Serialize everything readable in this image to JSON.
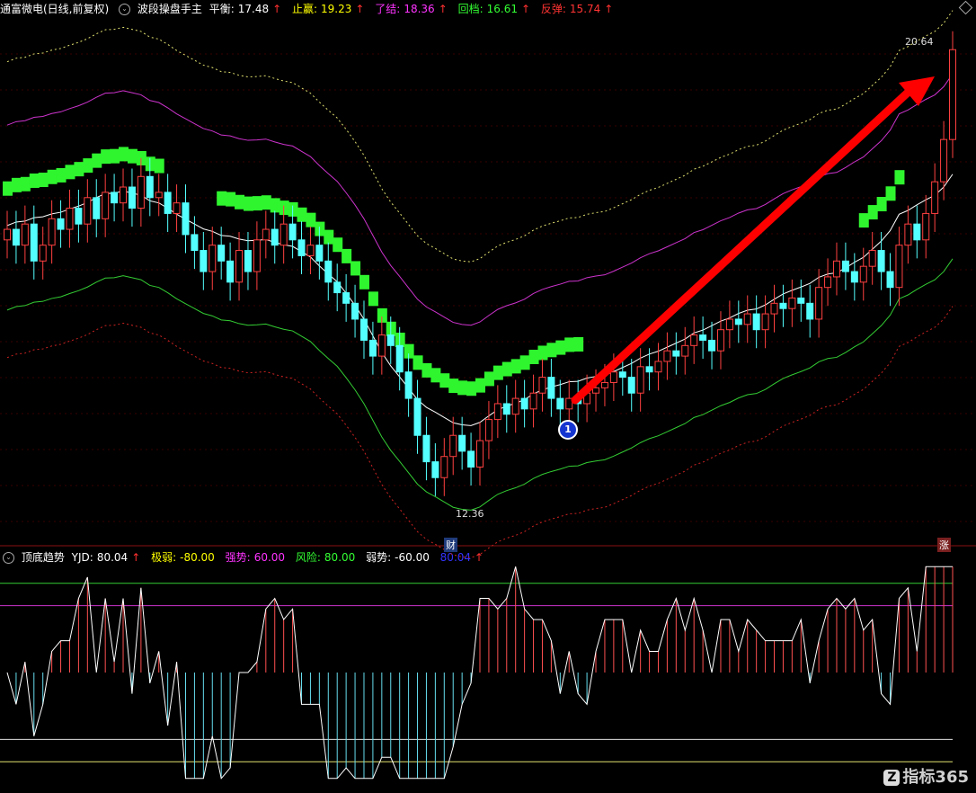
{
  "header": {
    "title": "通富微电(日线,前复权)",
    "indicator": "波段操盘手主",
    "items": [
      {
        "label": "平衡:",
        "value": "17.48",
        "color": "#ffffff"
      },
      {
        "label": "止赢:",
        "value": "19.23",
        "color": "#ffff00"
      },
      {
        "label": "了结:",
        "value": "18.36",
        "color": "#ff33ff"
      },
      {
        "label": "回档:",
        "value": "16.61",
        "color": "#33ff33"
      },
      {
        "label": "反弹:",
        "value": "15.74",
        "color": "#ff3333"
      }
    ]
  },
  "sub_header": {
    "indicator": "顶底趋势",
    "items": [
      {
        "label": "YJD:",
        "value": "80.04",
        "color": "#ffffff"
      },
      {
        "label": "极弱:",
        "value": "-80.00",
        "color": "#ffff00"
      },
      {
        "label": "强势:",
        "value": "60.00",
        "color": "#ff33ff"
      },
      {
        "label": "风险:",
        "value": "80.00",
        "color": "#33ff33"
      },
      {
        "label": "弱势:",
        "value": "-60.00",
        "color": "#ffffff"
      },
      {
        "label": "",
        "value": "80.04",
        "color": "#3333ff"
      }
    ]
  },
  "labels": {
    "high": "20.64",
    "low": "12.36",
    "marker_1": "1",
    "tag_left": "财",
    "tag_right": "涨",
    "watermark": "指标365"
  },
  "colors": {
    "up": "#ff4040",
    "down": "#54ffff",
    "green_band": "#2ff52f",
    "arrow": "#ff0000"
  },
  "chart_data": {
    "type": "candlestick",
    "ylim": [
      11.5,
      21.2
    ],
    "closes": [
      17.2,
      16.9,
      17.3,
      16.6,
      16.9,
      17.4,
      17.2,
      17.6,
      17.3,
      17.8,
      17.4,
      17.9,
      17.7,
      18.0,
      17.6,
      18.2,
      17.8,
      17.9,
      17.5,
      17.7,
      17.1,
      16.8,
      16.4,
      16.9,
      16.6,
      16.2,
      16.8,
      16.4,
      17.0,
      17.2,
      16.9,
      17.3,
      17.0,
      16.7,
      16.9,
      16.6,
      16.2,
      16.0,
      15.8,
      15.5,
      15.1,
      14.8,
      15.2,
      15.0,
      14.5,
      14.0,
      13.3,
      12.8,
      12.5,
      12.9,
      13.3,
      13.0,
      12.7,
      13.2,
      13.6,
      13.9,
      13.7,
      14.0,
      13.8,
      14.1,
      14.4,
      14.0,
      13.8,
      14.0,
      13.9,
      14.1,
      14.2,
      14.3,
      14.5,
      14.4,
      14.1,
      14.6,
      14.5,
      14.7,
      14.9,
      14.8,
      15.0,
      15.2,
      15.1,
      14.9,
      15.3,
      15.5,
      15.4,
      15.6,
      15.3,
      15.6,
      15.8,
      15.7,
      15.9,
      15.8,
      15.5,
      16.1,
      16.3,
      16.6,
      16.4,
      16.2,
      16.5,
      16.8,
      16.4,
      16.1,
      16.9,
      17.3,
      17.0,
      17.5,
      18.1,
      18.9,
      20.6
    ]
  }
}
